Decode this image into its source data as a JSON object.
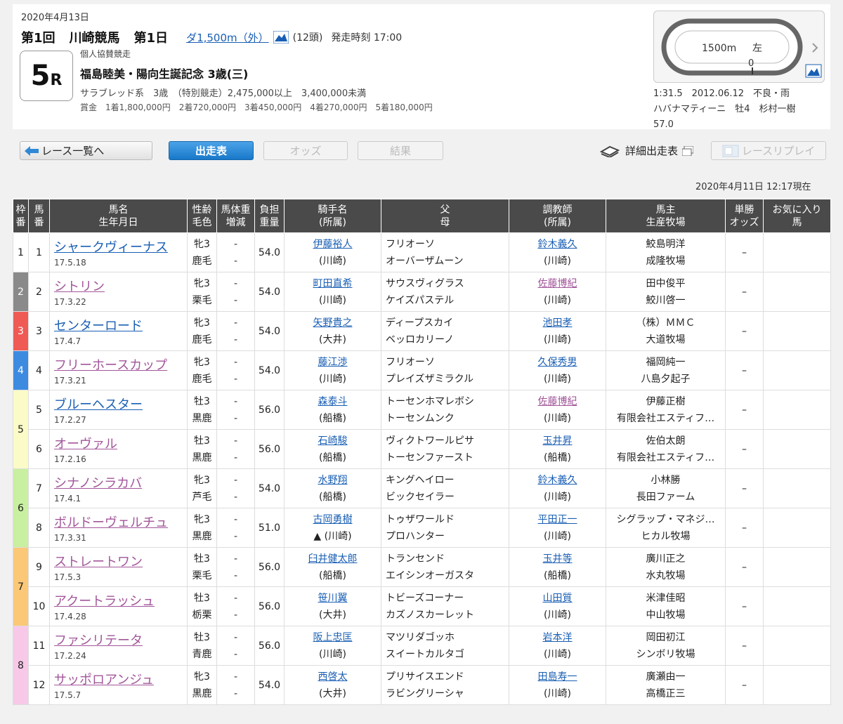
{
  "race": {
    "date": "2020年4月13日",
    "kai": "第1回",
    "venue": "川崎競馬",
    "day": "第1日",
    "distance": "ダ1,500m（外）",
    "heads": "(12頭)",
    "start": "発走時刻 17:00",
    "number": "5",
    "r_label": "R",
    "sponsor": "個人協賛競走",
    "name": "福島睦美・陽向生誕記念 3歳(三)",
    "conditions": "サラブレッド系　3歳　（特別競走）2,475,000以上　3,400,000未満",
    "prize_label": "賞金",
    "prizes": [
      "1着1,800,000円",
      "2着720,000円",
      "3着450,000円",
      "4着270,000円",
      "5着180,000円"
    ]
  },
  "course": {
    "length": "1500m",
    "direction": "左",
    "start_mark": "0"
  },
  "record": {
    "line1": "1:31.5　2012.06.12　不良・雨",
    "line2": "ハバナマティーニ　牡4　杉村一樹",
    "line3": "57.0"
  },
  "toolbar": {
    "back": "レース一覧へ",
    "entries": "出走表",
    "odds": "オッズ",
    "results": "結果",
    "detail": "詳細出走表",
    "replay": "レースリプレイ"
  },
  "as_of": "2020年4月11日 12:17現在",
  "headers": {
    "waku": [
      "枠",
      "番"
    ],
    "ban": [
      "馬",
      "番"
    ],
    "horse": [
      "馬名",
      "生年月日"
    ],
    "sex": [
      "性齢",
      "毛色"
    ],
    "weight": [
      "馬体重",
      "増減"
    ],
    "burden": [
      "負担",
      "重量"
    ],
    "jockey": [
      "騎手名",
      "(所属)"
    ],
    "sire": [
      "父",
      "母"
    ],
    "trainer": [
      "調教師",
      "(所属)"
    ],
    "owner": [
      "馬主",
      "生産牧場"
    ],
    "odds": [
      "単勝",
      "オッズ"
    ],
    "fav": [
      "お気に入り",
      "馬"
    ]
  },
  "colors": {
    "waku1": "#ffffff",
    "waku2": "#8a8a8a",
    "waku3": "#f05a55",
    "waku4": "#3d8be0",
    "waku5": "#fbfbc8",
    "waku6": "#c8f0a0",
    "waku7": "#fbc878",
    "waku8": "#f8c8e8"
  },
  "horses": [
    {
      "waku": "1",
      "ban": "1",
      "name": "シャークヴィーナス",
      "dob": "17.5.18",
      "sex": "牝3",
      "coat": "鹿毛",
      "w": "-",
      "wd": "-",
      "burden": "54.0",
      "jockey": "伊藤裕人",
      "jaff": "(川崎)",
      "sire": "フリオーソ",
      "dam": "オーバーザムーン",
      "trainer": "鈴木義久",
      "taff": "(川崎)",
      "owner": "鮫島明洋",
      "breeder": "成隆牧場",
      "odds": "–"
    },
    {
      "waku": "2",
      "ban": "2",
      "name": "シトリン",
      "dob": "17.3.22",
      "sex": "牝3",
      "coat": "栗毛",
      "w": "-",
      "wd": "-",
      "burden": "54.0",
      "jockey": "町田直希",
      "jaff": "(川崎)",
      "sire": "サウスヴィグラス",
      "dam": "ケイズパステル",
      "trainer": "佐藤博紀",
      "taff": "(川崎)",
      "owner": "田中俊平",
      "breeder": "鮫川啓一",
      "odds": "–"
    },
    {
      "waku": "3",
      "ban": "3",
      "name": "センターロード",
      "dob": "17.4.7",
      "sex": "牝3",
      "coat": "鹿毛",
      "w": "-",
      "wd": "-",
      "burden": "54.0",
      "jockey": "矢野貴之",
      "jaff": "(大井)",
      "sire": "ディープスカイ",
      "dam": "ベッロカリーノ",
      "trainer": "池田孝",
      "taff": "(川崎)",
      "owner": "（株）ＭＭＣ",
      "breeder": "大道牧場",
      "odds": "–"
    },
    {
      "waku": "4",
      "ban": "4",
      "name": "フリーホースカップ",
      "dob": "17.3.21",
      "sex": "牝3",
      "coat": "鹿毛",
      "w": "-",
      "wd": "-",
      "burden": "54.0",
      "jockey": "藤江渉",
      "jaff": "(川崎)",
      "sire": "フリオーソ",
      "dam": "プレイズザミラクル",
      "trainer": "久保秀男",
      "taff": "(川崎)",
      "owner": "福岡純一",
      "breeder": "八島夕起子",
      "odds": "–"
    },
    {
      "waku": "5",
      "ban": "5",
      "name": "ブルーヘスター",
      "dob": "17.2.27",
      "sex": "牡3",
      "coat": "黒鹿",
      "w": "-",
      "wd": "-",
      "burden": "56.0",
      "jockey": "森泰斗",
      "jaff": "(船橋)",
      "sire": "トーセンホマレボシ",
      "dam": "トーセンムンク",
      "trainer": "佐藤博紀",
      "taff": "(川崎)",
      "owner": "伊藤正樹",
      "breeder": "有限会社エスティフ…",
      "odds": "–"
    },
    {
      "waku": "5",
      "ban": "6",
      "name": "オーヴァル",
      "dob": "17.2.16",
      "sex": "牡3",
      "coat": "黒鹿",
      "w": "-",
      "wd": "-",
      "burden": "56.0",
      "jockey": "石崎駿",
      "jaff": "(船橋)",
      "sire": "ヴィクトワールピサ",
      "dam": "トーセンファースト",
      "trainer": "玉井昇",
      "taff": "(船橋)",
      "owner": "佐伯太朗",
      "breeder": "有限会社エスティフ…",
      "odds": "–"
    },
    {
      "waku": "6",
      "ban": "7",
      "name": "シナノシラカバ",
      "dob": "17.4.1",
      "sex": "牝3",
      "coat": "芦毛",
      "w": "-",
      "wd": "-",
      "burden": "54.0",
      "jockey": "水野翔",
      "jaff": "(船橋)",
      "sire": "キングヘイロー",
      "dam": "ビックセイラー",
      "trainer": "鈴木義久",
      "taff": "(川崎)",
      "owner": "小林勝",
      "breeder": "長田ファーム",
      "odds": "–"
    },
    {
      "waku": "6",
      "ban": "8",
      "name": "ボルドーヴェルチュ",
      "dob": "17.3.31",
      "sex": "牝3",
      "coat": "黒鹿",
      "w": "-",
      "wd": "-",
      "burden": "51.0",
      "jockey": "古岡勇樹",
      "jaff": "▲ (川崎)",
      "sire": "トゥザワールド",
      "dam": "プロハンター",
      "trainer": "平田正一",
      "taff": "(川崎)",
      "owner": "シグラップ・マネジ…",
      "breeder": "ヒカル牧場",
      "odds": "–"
    },
    {
      "waku": "7",
      "ban": "9",
      "name": "ストレートワン",
      "dob": "17.5.3",
      "sex": "牡3",
      "coat": "栗毛",
      "w": "-",
      "wd": "-",
      "burden": "56.0",
      "jockey": "臼井健太郎",
      "jaff": "(船橋)",
      "sire": "トランセンド",
      "dam": "エイシンオーガスタ",
      "trainer": "玉井等",
      "taff": "(船橋)",
      "owner": "廣川正之",
      "breeder": "水丸牧場",
      "odds": "–"
    },
    {
      "waku": "7",
      "ban": "10",
      "name": "アクートラッシュ",
      "dob": "17.4.28",
      "sex": "牡3",
      "coat": "栃栗",
      "w": "-",
      "wd": "-",
      "burden": "56.0",
      "jockey": "笹川翼",
      "jaff": "(大井)",
      "sire": "トビーズコーナー",
      "dam": "カズノスカーレット",
      "trainer": "山田質",
      "taff": "(川崎)",
      "owner": "米津佳昭",
      "breeder": "中山牧場",
      "odds": "–"
    },
    {
      "waku": "8",
      "ban": "11",
      "name": "ファシリテータ",
      "dob": "17.2.24",
      "sex": "牡3",
      "coat": "青鹿",
      "w": "-",
      "wd": "-",
      "burden": "56.0",
      "jockey": "阪上忠匡",
      "jaff": "(川崎)",
      "sire": "マツリダゴッホ",
      "dam": "スイートカルタゴ",
      "trainer": "岩本洋",
      "taff": "(川崎)",
      "owner": "岡田初江",
      "breeder": "シンボリ牧場",
      "odds": "–"
    },
    {
      "waku": "8",
      "ban": "12",
      "name": "サッポロアンジュ",
      "dob": "17.5.7",
      "sex": "牝3",
      "coat": "黒鹿",
      "w": "-",
      "wd": "-",
      "burden": "54.0",
      "jockey": "西啓太",
      "jaff": "(大井)",
      "sire": "プリサイスエンド",
      "dam": "ラビングリーシャ",
      "trainer": "田島寿一",
      "taff": "(川崎)",
      "owner": "廣瀬由一",
      "breeder": "高橋正三",
      "odds": "–"
    }
  ]
}
